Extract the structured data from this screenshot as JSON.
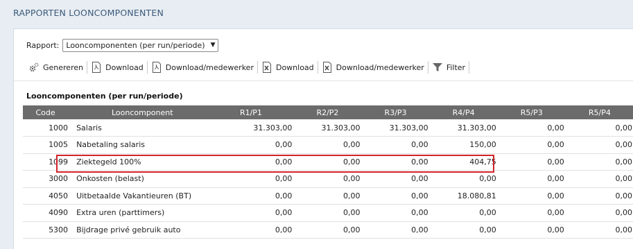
{
  "page": {
    "title": "RAPPORTEN LOONCOMPONENTEN"
  },
  "rapport": {
    "label": "Rapport:",
    "selected": "Looncomponenten (per run/periode)"
  },
  "toolbar": {
    "items": [
      {
        "label": "Genereren",
        "icon": "gears-icon"
      },
      {
        "label": "Download",
        "icon": "pdf-icon"
      },
      {
        "label": "Download/medewerker",
        "icon": "pdf-icon"
      },
      {
        "label": "Download",
        "icon": "excel-icon"
      },
      {
        "label": "Download/medewerker",
        "icon": "excel-icon"
      },
      {
        "label": "Filter",
        "icon": "filter-icon"
      }
    ]
  },
  "section": {
    "title": "Looncomponenten (per run/periode)"
  },
  "table": {
    "headers": [
      "Code",
      "Looncomponent",
      "R1/P1",
      "R2/P2",
      "R3/P3",
      "R4/P4",
      "R5/P3",
      "R5/P4"
    ],
    "rows": [
      {
        "code": "1000",
        "name": "Salaris",
        "values": [
          "31.303,00",
          "31.303,00",
          "31.303,00",
          "31.303,00",
          "0,00",
          "0,00"
        ]
      },
      {
        "code": "1005",
        "name": "Nabetaling salaris",
        "values": [
          "0,00",
          "0,00",
          "0,00",
          "150,00",
          "0,00",
          "0,00"
        ]
      },
      {
        "code": "1099",
        "name": "Ziektegeld 100%",
        "values": [
          "0,00",
          "0,00",
          "0,00",
          "404,75",
          "0,00",
          "0,00"
        ]
      },
      {
        "code": "3000",
        "name": "Onkosten (belast)",
        "values": [
          "0,00",
          "0,00",
          "0,00",
          "0,00",
          "0,00",
          "0,00"
        ]
      },
      {
        "code": "4050",
        "name": "Uitbetaalde Vakantieuren (BT)",
        "values": [
          "0,00",
          "0,00",
          "0,00",
          "18.080,81",
          "0,00",
          "0,00"
        ]
      },
      {
        "code": "4090",
        "name": "Extra uren (parttimers)",
        "values": [
          "0,00",
          "0,00",
          "0,00",
          "0,00",
          "0,00",
          "0,00"
        ]
      },
      {
        "code": "5300",
        "name": "Bijdrage privé gebruik auto",
        "values": [
          "0,00",
          "0,00",
          "0,00",
          "0,00",
          "0,00",
          "0,00"
        ]
      }
    ]
  },
  "colors": {
    "header_bg": "#6b6b6b",
    "highlight": "#d3232a",
    "title": "#3a5a7a"
  }
}
